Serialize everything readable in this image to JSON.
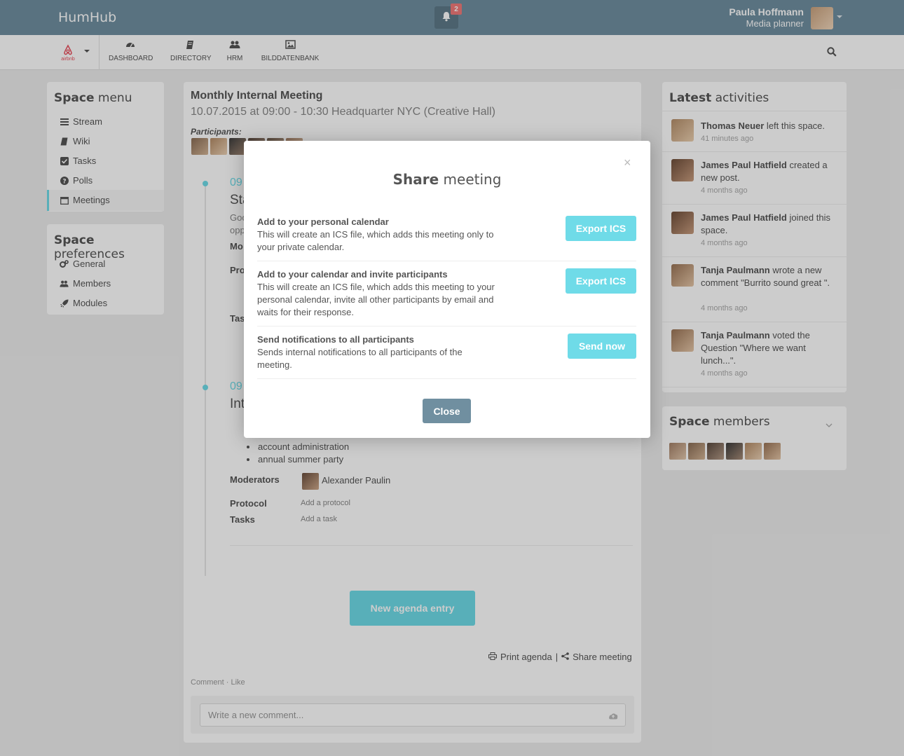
{
  "topbar": {
    "brand": "HumHub",
    "notification_count": "2",
    "user_name": "Paula Hoffmann",
    "user_role": "Media planner"
  },
  "space": {
    "logo_text": "airbnb"
  },
  "nav": {
    "items": [
      {
        "label": "DASHBOARD",
        "icon": "dashboard-icon"
      },
      {
        "label": "DIRECTORY",
        "icon": "book-icon"
      },
      {
        "label": "HRM",
        "icon": "users-icon"
      },
      {
        "label": "BILDDATENBANK",
        "icon": "image-icon"
      }
    ]
  },
  "space_menu": {
    "title_bold": "Space",
    "title_rest": "menu",
    "items": [
      {
        "label": "Stream",
        "icon": "list-icon"
      },
      {
        "label": "Wiki",
        "icon": "book-icon"
      },
      {
        "label": "Tasks",
        "icon": "checkbox-icon"
      },
      {
        "label": "Polls",
        "icon": "question-icon"
      },
      {
        "label": "Meetings",
        "icon": "calendar-icon",
        "active": true
      }
    ]
  },
  "space_prefs": {
    "title_bold": "Space",
    "title_rest": "preferences",
    "items": [
      {
        "label": "General",
        "icon": "cogs-icon"
      },
      {
        "label": "Members",
        "icon": "users-icon"
      },
      {
        "label": "Modules",
        "icon": "rocket-icon"
      }
    ]
  },
  "meeting": {
    "title": "Monthly Internal Meeting",
    "subtitle": "10.07.2015 at 09:00 - 10:30 Headquarter NYC (Creative Hall)",
    "participants_label": "Participants:",
    "entry1": {
      "time": "09",
      "title": "Sta",
      "line1": "Goo",
      "line2": "opp",
      "label_mo": "Mo",
      "label_pro": "Pro",
      "label_tas": "Tas"
    },
    "entry2": {
      "time": "09",
      "title": "Int",
      "bullets": [
        "account administration",
        "annual summer party"
      ],
      "moderators_label": "Moderators",
      "moderator_name": "Alexander Paulin",
      "protocol_label": "Protocol",
      "protocol_placeholder": "Add a protocol",
      "tasks_label": "Tasks",
      "tasks_placeholder": "Add a task"
    },
    "new_agenda_label": "New agenda entry",
    "print_agenda": "Print agenda",
    "separator": "|",
    "share_meeting": "Share meeting",
    "comment_like": "Comment · Like",
    "comment_placeholder": "Write a new comment..."
  },
  "activities": {
    "title_bold": "Latest",
    "title_rest": "activities",
    "items": [
      {
        "actor": "Thomas Neuer",
        "text": " left this space.",
        "time": "41 minutes ago"
      },
      {
        "actor": "James Paul Hatfield",
        "text": " created a new post.",
        "time": "4 months ago"
      },
      {
        "actor": "James Paul Hatfield",
        "text": " joined this space.",
        "time": "4 months ago"
      },
      {
        "actor": "Tanja Paulmann",
        "text": " wrote a new comment \"Burrito sound great \".",
        "time": "4 months ago"
      },
      {
        "actor": "Tanja Paulmann",
        "text": " voted the Question \"Where we want lunch...\".",
        "time": "4 months ago"
      }
    ]
  },
  "members": {
    "title_bold": "Space",
    "title_rest": "members"
  },
  "modal": {
    "title_bold": "Share",
    "title_rest": "meeting",
    "close_x": "×",
    "rows": [
      {
        "title": "Add to your personal calendar",
        "desc": "This will create an ICS file, which adds this meeting only to your private calendar.",
        "button": "Export ICS"
      },
      {
        "title": "Add to your calendar and invite participants",
        "desc": "This will create an ICS file, which adds this meeting to your personal calendar, invite all other participants by email and waits for their response.",
        "button": "Export ICS"
      },
      {
        "title": "Send notifications to all participants",
        "desc": "Sends internal notifications to all participants of the meeting.",
        "button": "Send now"
      }
    ],
    "close_label": "Close"
  },
  "colors": {
    "topbar": "#708fa0",
    "accent": "#6fdbe8",
    "badge": "#f07a7a",
    "page_bg": "#ededed"
  }
}
